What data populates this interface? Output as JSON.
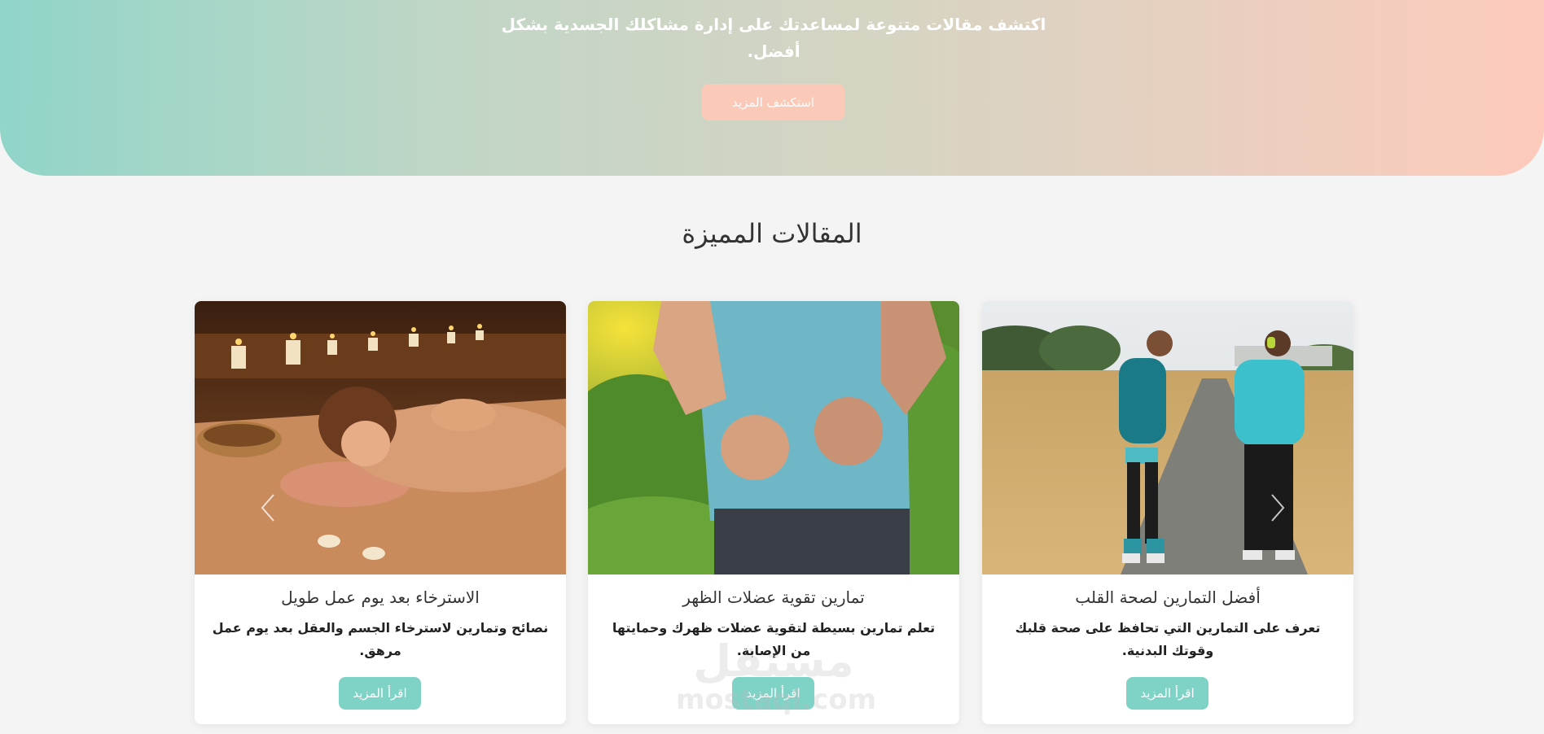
{
  "hero": {
    "description": "اكتشف مقالات متنوعة لمساعدتك على إدارة مشاكلك الجسدية بشكل أفضل.",
    "cta_label": "استكشف المزيد"
  },
  "featured": {
    "title": "المقالات المميزة",
    "cards": [
      {
        "title": "أفضل التمارين لصحة القلب",
        "description": "تعرف على التمارين التي تحافظ على صحة قلبك وقوتك البدنية.",
        "button_label": "اقرأ المزيد"
      },
      {
        "title": "تمارين تقوية عضلات الظهر",
        "description": "تعلم تمارين بسيطة لتقوية عضلات ظهرك وحمايتها من الإصابة.",
        "button_label": "اقرأ المزيد"
      },
      {
        "title": "الاسترخاء بعد يوم عمل طويل",
        "description": "نصائح وتمارين لاسترخاء الجسم والعقل بعد يوم عمل مرهق.",
        "button_label": "اقرأ المزيد"
      }
    ]
  },
  "watermark": {
    "arabic": "مستقل",
    "latin": "mostaql.com"
  },
  "colors": {
    "hero_gradient_start": "#90d5c8",
    "hero_gradient_end": "#fdcabc",
    "hero_button": "#fbc9b8",
    "card_button": "#7fd3c6"
  },
  "icons": {
    "prev": "chevron-left-icon",
    "next": "chevron-right-icon"
  }
}
